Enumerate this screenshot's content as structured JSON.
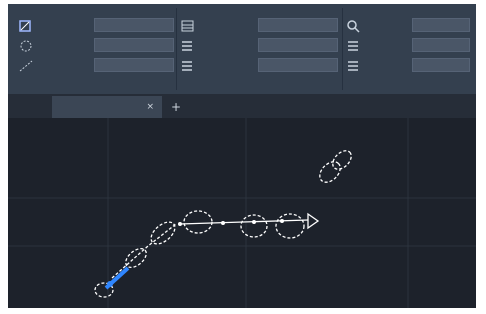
{
  "ribbon": {
    "panels": [
      {
        "name": "",
        "rows": [
          {
            "icon": "axis-icon",
            "label": "",
            "value": ""
          },
          {
            "icon": "rotate-icon",
            "label": "",
            "value": ""
          },
          {
            "icon": "scale-icon",
            "label": "",
            "value": ""
          }
        ]
      },
      {
        "name": "",
        "rows": [
          {
            "icon": "table-icon",
            "label": "",
            "value": ""
          },
          {
            "icon": "list-icon",
            "label": "",
            "value": ""
          },
          {
            "icon": "list-icon",
            "label": "",
            "value": ""
          }
        ]
      },
      {
        "name": "",
        "rows": [
          {
            "icon": "search-icon",
            "label": "",
            "value": ""
          },
          {
            "icon": "list-icon",
            "label": "",
            "value": ""
          },
          {
            "icon": "list-icon",
            "label": "",
            "value": ""
          }
        ]
      }
    ]
  },
  "tabs": [
    {
      "label": "",
      "close": "×"
    }
  ],
  "add_tab_label": "+",
  "viewport": {
    "label": ""
  },
  "colors": {
    "accent": "#2f86ff",
    "background": "#1d222b",
    "ribbon": "#34404f"
  }
}
